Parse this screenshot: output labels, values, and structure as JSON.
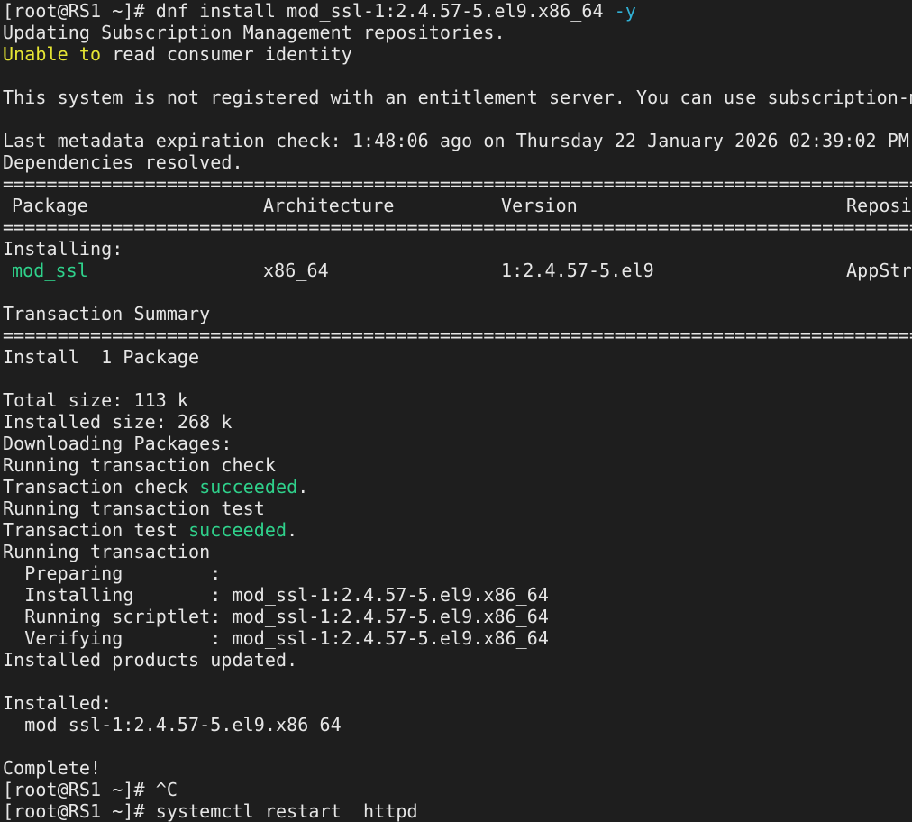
{
  "colors": {
    "background": "#1e1e1e",
    "text": "#e6e6e6",
    "cyan": "#31b0d4",
    "yellow": "#e5e534",
    "green": "#2fd18b"
  },
  "lines": {
    "l1_prompt": "[root@RS1 ~]# ",
    "l1_cmd": "dnf install mod_ssl-1:2.4.57-5.el9.x86_64 ",
    "l1_flag": "-y",
    "l2": "Updating Subscription Management repositories.",
    "l3_warn": "Unable to",
    "l3_rest": " read consumer identity",
    "l5": "This system is not registered with an entitlement server. You can use subscription-m",
    "l7": "Last metadata expiration check: 1:48:06 ago on Thursday 22 January 2026 02:39:02 PM.",
    "l8": "Dependencies resolved.",
    "sep": "================================================================================================",
    "installing_heading": "Installing:",
    "transaction_summary": "Transaction Summary",
    "install_count": "Install  1 Package",
    "total_size": "Total size: 113 k",
    "installed_size": "Installed size: 268 k",
    "downloading": "Downloading Packages:",
    "running_check": "Running transaction check",
    "check_prefix": "Transaction check ",
    "check_status": "succeeded",
    "check_suffix": ".",
    "running_test": "Running transaction test",
    "test_prefix": "Transaction test ",
    "test_status": "succeeded",
    "test_suffix": ".",
    "running_tx": "Running transaction",
    "preparing": "  Preparing        :",
    "installing_step": "  Installing       : mod_ssl-1:2.4.57-5.el9.x86_64",
    "scriptlet_step": "  Running scriptlet: mod_ssl-1:2.4.57-5.el9.x86_64",
    "verifying_step": "  Verifying        : mod_ssl-1:2.4.57-5.el9.x86_64",
    "products_updated": "Installed products updated.",
    "installed_heading": "Installed:",
    "installed_pkg": "  mod_ssl-1:2.4.57-5.el9.x86_64",
    "complete": "Complete!",
    "ctrl_c_prompt": "[root@RS1 ~]# ",
    "ctrl_c": "^C",
    "last_prompt": "[root@RS1 ~]# ",
    "last_cmd": "systemctl restart  httpd"
  },
  "table": {
    "headers": {
      "package": "Package",
      "architecture": "Architecture",
      "version": "Version",
      "repository": "Reposi"
    },
    "rows": [
      {
        "package": "mod_ssl",
        "arch": "x86_64",
        "version": "1:2.4.57-5.el9",
        "repo": "AppStr"
      }
    ]
  }
}
